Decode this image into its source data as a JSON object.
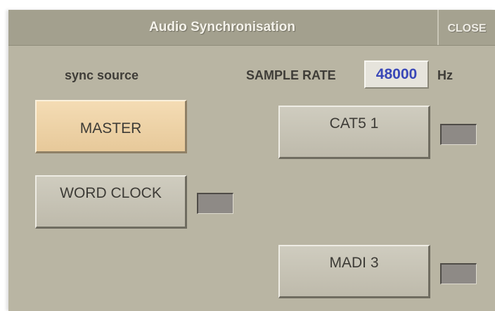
{
  "dialog": {
    "title": "Audio Synchronisation",
    "close_label": "CLOSE"
  },
  "sync_source": {
    "label": "sync source"
  },
  "sample_rate": {
    "label": "SAMPLE RATE",
    "value": "48000",
    "unit": "Hz"
  },
  "buttons": {
    "master": "MASTER",
    "word_clock": "WORD CLOCK",
    "cat5_1": "CAT5 1",
    "madi_3": "MADI 3"
  },
  "state": {
    "selected_source": "MASTER"
  },
  "colors": {
    "panel": "#b9b5a3",
    "titlebar": "#a3a08e",
    "active_button": "#f0d7ad",
    "rate_value": "#3947b8",
    "indicator_off": "#8e8a86"
  }
}
